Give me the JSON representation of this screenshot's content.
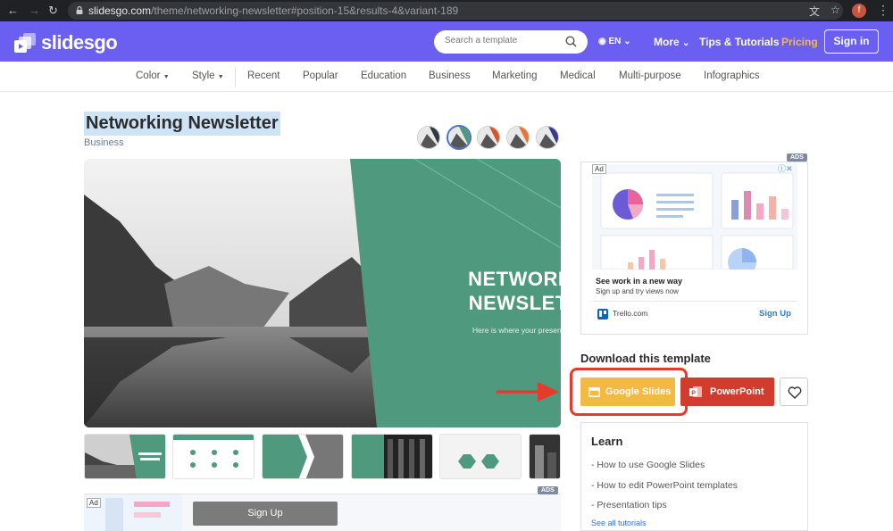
{
  "browser": {
    "url_host": "slidesgo.com",
    "url_path": "/theme/networking-newsletter#position-15&results-4&variant-189"
  },
  "header": {
    "logo": "slidesgo",
    "search_placeholder": "Search a template",
    "language": "EN",
    "nav": [
      "More",
      "Tips & Tutorials",
      "Pricing"
    ],
    "signin": "Sign in"
  },
  "categories": {
    "filters": [
      "Color",
      "Style"
    ],
    "items": [
      "Recent",
      "Popular",
      "Education",
      "Business",
      "Marketing",
      "Medical",
      "Multi-purpose",
      "Infographics"
    ]
  },
  "template": {
    "title": "Networking Newsletter",
    "category": "Business",
    "hero_title_line1": "NETWORKING",
    "hero_title_line2": "NEWSLETTER",
    "hero_subtitle": "Here is where your presentation begins",
    "variant_colors": [
      "#2f3a45",
      "#4b9a7d",
      "#d9542b",
      "#e8762e",
      "#3b3a8f"
    ],
    "accent_color": "#4f9a7e"
  },
  "ad_right": {
    "badge": "ADS",
    "ad_label": "Ad",
    "headline": "See work in a new way",
    "subline": "Sign up and try views now",
    "site": "Trello.com",
    "cta": "Sign Up"
  },
  "download": {
    "title": "Download this template",
    "google_slides": "Google Slides",
    "powerpoint": "PowerPoint",
    "google_color": "#f4b942",
    "powerpoint_color": "#d13c2d"
  },
  "learn": {
    "title": "Learn",
    "items": [
      "- How to use Google Slides",
      "- How to edit PowerPoint templates",
      "- Presentation tips"
    ],
    "see_all": "See all tutorials"
  },
  "ad_bottom": {
    "badge": "ADS",
    "ad_label": "Ad",
    "cta": "Sign Up"
  }
}
